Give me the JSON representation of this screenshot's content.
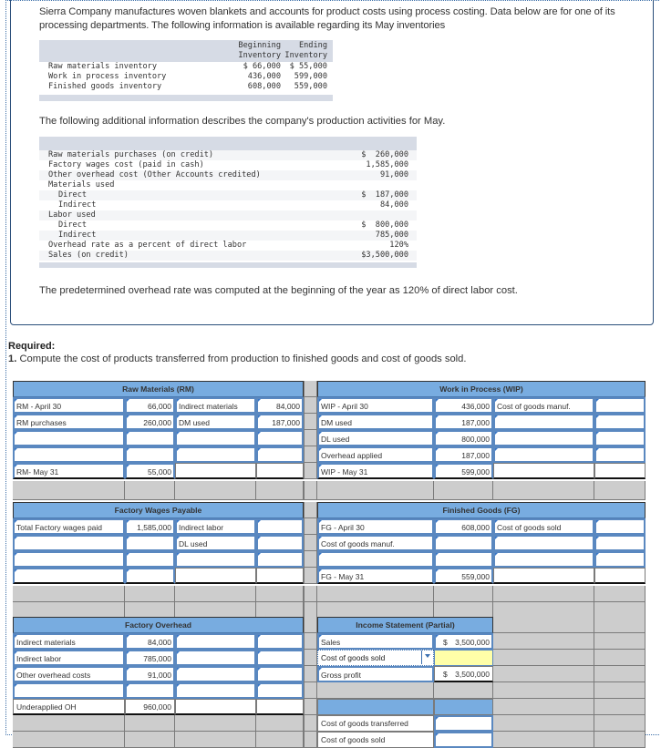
{
  "intro": {
    "text": "Sierra Company manufactures woven blankets and accounts for product costs using process costing. Data below are for one of its processing departments. The following information is available regarding its May inventories"
  },
  "inventory_table": {
    "col_beginning": [
      "Beginning",
      "Inventory"
    ],
    "col_ending": [
      "Ending",
      "Inventory"
    ],
    "rows": [
      {
        "label": "Raw materials inventory",
        "beginning": "$ 66,000",
        "ending": "$ 55,000"
      },
      {
        "label": "Work in process inventory",
        "beginning": "436,000",
        "ending": "599,000"
      },
      {
        "label": "Finished goods inventory",
        "beginning": "608,000",
        "ending": "559,000"
      }
    ]
  },
  "activities_intro": "The following additional information describes the company's production activities for May.",
  "activities": [
    {
      "label": "Raw materials purchases (on credit)",
      "value": "$  260,000",
      "indent": false
    },
    {
      "label": "Factory wages cost (paid in cash)",
      "value": "1,585,000",
      "indent": false
    },
    {
      "label": "Other overhead cost (Other Accounts credited)",
      "value": "91,000",
      "indent": false
    },
    {
      "label": "Materials used",
      "value": "",
      "indent": false
    },
    {
      "label": "Direct",
      "value": "$  187,000",
      "indent": true
    },
    {
      "label": "Indirect",
      "value": "84,000",
      "indent": true
    },
    {
      "label": "Labor used",
      "value": "",
      "indent": false
    },
    {
      "label": "Direct",
      "value": "$  800,000",
      "indent": true
    },
    {
      "label": "Indirect",
      "value": "785,000",
      "indent": true
    },
    {
      "label": "Overhead rate as a percent of direct labor",
      "value": "120%",
      "indent": false
    },
    {
      "label": "Sales (on credit)",
      "value": "$3,500,000",
      "indent": false
    }
  ],
  "overhead_note": "The predetermined overhead rate was computed at the beginning of the year as 120% of direct labor cost.",
  "required": {
    "heading": "Required:",
    "number": "1.",
    "text": " Compute the cost of products transferred from production to finished goods and cost of goods sold."
  },
  "t_accounts": {
    "raw_materials": {
      "title": "Raw Materials (RM)",
      "rows": [
        [
          "RM - April 30",
          "66,000",
          "Indirect materials",
          "84,000"
        ],
        [
          "RM purchases",
          "260,000",
          "DM used",
          "187,000"
        ],
        [
          "",
          "",
          "",
          ""
        ],
        [
          "",
          "",
          "",
          ""
        ],
        [
          "RM- May 31",
          "55,000",
          "",
          ""
        ]
      ]
    },
    "work_in_process": {
      "title": "Work in Process (WIP)",
      "rows": [
        [
          "WIP - April 30",
          "436,000",
          "Cost of goods manuf.",
          ""
        ],
        [
          "DM used",
          "187,000",
          "",
          ""
        ],
        [
          "DL used",
          "800,000",
          "",
          ""
        ],
        [
          "Overhead applied",
          "187,000",
          "",
          ""
        ],
        [
          "WIP - May 31",
          "599,000",
          "",
          ""
        ]
      ]
    },
    "factory_wages_payable": {
      "title": "Factory Wages Payable",
      "rows": [
        [
          "Total Factory wages paid",
          "1,585,000",
          "Indirect labor",
          ""
        ],
        [
          "",
          "",
          "DL used",
          ""
        ],
        [
          "",
          "",
          "",
          ""
        ],
        [
          "",
          "",
          "",
          ""
        ]
      ]
    },
    "finished_goods": {
      "title": "Finished Goods (FG)",
      "rows": [
        [
          "FG - April 30",
          "608,000",
          "Cost of goods sold",
          ""
        ],
        [
          "Cost of goods manuf.",
          "",
          "",
          ""
        ],
        [
          "",
          "",
          "",
          ""
        ],
        [
          "FG - May 31",
          "559,000",
          "",
          ""
        ]
      ]
    },
    "factory_overhead": {
      "title": "Factory Overhead",
      "rows": [
        [
          "Indirect materials",
          "84,000",
          "",
          ""
        ],
        [
          "Indirect labor",
          "785,000",
          "",
          ""
        ],
        [
          "Other overhead costs",
          "91,000",
          "",
          ""
        ],
        [
          "",
          "",
          "",
          ""
        ],
        [
          "Underapplied OH",
          "960,000",
          "",
          ""
        ]
      ]
    }
  },
  "income_statement": {
    "title": "Income Statement (Partial)",
    "sales_label": "Sales",
    "sales_currency": "$",
    "sales_value": "3,500,000",
    "cogs_label": "Cost of goods sold",
    "cogs_value": "",
    "gross_profit_label": "Gross profit",
    "gross_profit_currency": "$",
    "gross_profit_value": "3,500,000"
  },
  "summary": {
    "rows": [
      {
        "label": "Cost of goods transferred",
        "value": ""
      },
      {
        "label": "Cost of goods sold",
        "value": ""
      }
    ]
  }
}
